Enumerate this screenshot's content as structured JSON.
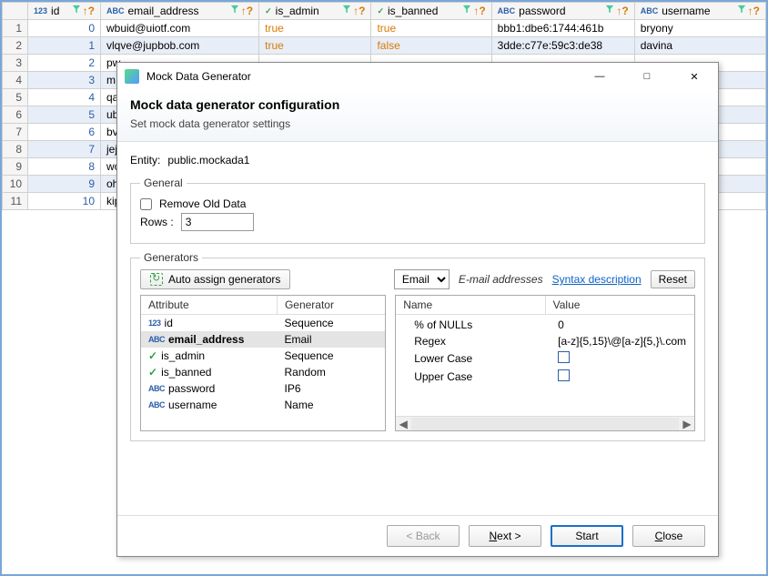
{
  "grid": {
    "columns": [
      {
        "name": "id",
        "type": "123"
      },
      {
        "name": "email_address",
        "type": "ABC"
      },
      {
        "name": "is_admin",
        "type": "chk"
      },
      {
        "name": "is_banned",
        "type": "chk"
      },
      {
        "name": "password",
        "type": "ABC"
      },
      {
        "name": "username",
        "type": "ABC"
      }
    ],
    "rows": [
      {
        "n": "1",
        "id": "0",
        "email": "wbuid@uiotf.com",
        "admin": "true",
        "banned": "true",
        "pwd": "bbb1:dbe6:1744:461b",
        "user": "bryony"
      },
      {
        "n": "2",
        "id": "1",
        "email": "vlqve@jupbob.com",
        "admin": "true",
        "banned": "false",
        "pwd": "3dde:c77e:59c3:de38",
        "user": "davina"
      },
      {
        "n": "3",
        "id": "2",
        "email": "pw",
        "admin": "",
        "banned": "",
        "pwd": "",
        "user": ""
      },
      {
        "n": "4",
        "id": "3",
        "email": "m",
        "admin": "",
        "banned": "",
        "pwd": "",
        "user": ""
      },
      {
        "n": "5",
        "id": "4",
        "email": "qa",
        "admin": "",
        "banned": "",
        "pwd": "",
        "user": ""
      },
      {
        "n": "6",
        "id": "5",
        "email": "ub",
        "admin": "",
        "banned": "",
        "pwd": "",
        "user": ""
      },
      {
        "n": "7",
        "id": "6",
        "email": "bv",
        "admin": "",
        "banned": "",
        "pwd": "",
        "user": ""
      },
      {
        "n": "8",
        "id": "7",
        "email": "jej",
        "admin": "",
        "banned": "",
        "pwd": "",
        "user": ""
      },
      {
        "n": "9",
        "id": "8",
        "email": "wc",
        "admin": "",
        "banned": "",
        "pwd": "",
        "user": ""
      },
      {
        "n": "10",
        "id": "9",
        "email": "oh",
        "admin": "",
        "banned": "",
        "pwd": "",
        "user": ""
      },
      {
        "n": "11",
        "id": "10",
        "email": "kip",
        "admin": "",
        "banned": "",
        "pwd": "",
        "user": ""
      }
    ]
  },
  "dialog": {
    "title": "Mock Data Generator",
    "header_title": "Mock data generator configuration",
    "header_sub": "Set mock data generator settings",
    "entity_label": "Entity:",
    "entity_value": "public.mockada1",
    "general_legend": "General",
    "remove_old_label": "Remove Old Data",
    "rows_label": "Rows :",
    "rows_value": "3",
    "generators_legend": "Generators",
    "auto_assign_label": "Auto assign generators",
    "email_select": "Email",
    "email_desc": "E-mail addresses",
    "syntax_link": "Syntax description",
    "reset_label": "Reset",
    "attr_head": "Attribute",
    "gen_head": "Generator",
    "name_head": "Name",
    "value_head": "Value",
    "attrs": [
      {
        "type": "123",
        "name": "id",
        "gen": "Sequence",
        "sel": false
      },
      {
        "type": "ABC",
        "name": "email_address",
        "gen": "Email",
        "sel": true
      },
      {
        "type": "chk",
        "name": "is_admin",
        "gen": "Sequence",
        "sel": false
      },
      {
        "type": "chk",
        "name": "is_banned",
        "gen": "Random",
        "sel": false
      },
      {
        "type": "ABC",
        "name": "password",
        "gen": "IP6",
        "sel": false
      },
      {
        "type": "ABC",
        "name": "username",
        "gen": "Name",
        "sel": false
      }
    ],
    "props": [
      {
        "name": "% of NULLs",
        "value": "0",
        "kind": "text"
      },
      {
        "name": "Regex",
        "value": "[a-z]{5,15}\\@[a-z]{5,}\\.com",
        "kind": "text"
      },
      {
        "name": "Lower Case",
        "value": "",
        "kind": "check"
      },
      {
        "name": "Upper Case",
        "value": "",
        "kind": "check"
      }
    ],
    "btn_back": "< Back",
    "btn_next": "Next >",
    "btn_start": "Start",
    "btn_close": "Close"
  }
}
